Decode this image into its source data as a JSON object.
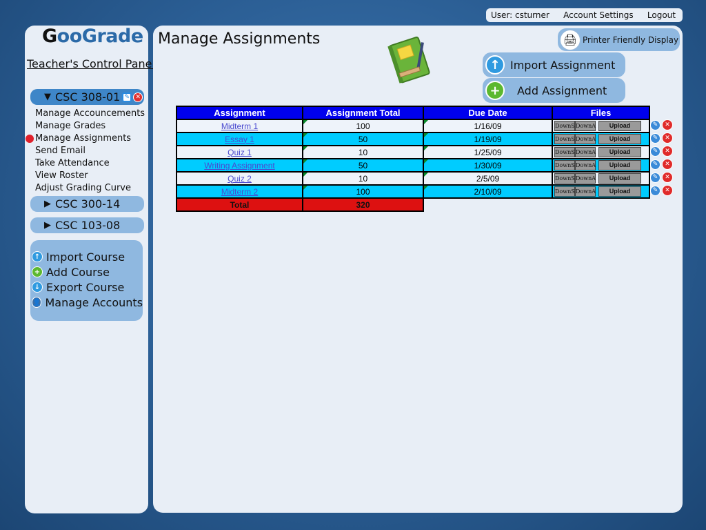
{
  "topbar": {
    "user_text": "User: csturner",
    "account_settings": "Account Settings",
    "logout": "Logout"
  },
  "sidebar": {
    "logo": {
      "g1": "G",
      "oo": "oo",
      "g2": "G",
      "rade": "rade"
    },
    "panel_title": "Teacher's Control Panel",
    "courses": [
      {
        "label": "CSC 308-01",
        "expanded": true
      },
      {
        "label": "CSC 300-14",
        "expanded": false
      },
      {
        "label": "CSC 103-08",
        "expanded": false
      }
    ],
    "subnav": [
      "Manage Accouncements",
      "Manage Grades",
      "Manage Assignments",
      "Send Email",
      "Take Attendance",
      "View Roster",
      "Adjust Grading Curve"
    ],
    "actions": [
      {
        "label": "Import Course",
        "icon": "import-icon"
      },
      {
        "label": "Add Course",
        "icon": "add-icon"
      },
      {
        "label": "Export Course",
        "icon": "export-icon"
      },
      {
        "label": "Manage Accounts",
        "icon": "accounts-icon"
      }
    ]
  },
  "main": {
    "title": "Manage Assignments",
    "printer_button": "Printer Friendly Display",
    "import_button": "Import Assignment",
    "add_button": "Add Assignment",
    "table": {
      "headers": [
        "Assignment",
        "Assignment Total",
        "Due Date",
        "Files"
      ],
      "rows": [
        {
          "name": "Midterm 1",
          "total": "100",
          "due": "1/16/09"
        },
        {
          "name": "Essay 1",
          "total": "50",
          "due": "1/19/09"
        },
        {
          "name": "Quiz 1",
          "total": "10",
          "due": "1/25/09"
        },
        {
          "name": "Writing Assignment",
          "total": "50",
          "due": "1/30/09"
        },
        {
          "name": "Quiz 2",
          "total": "10",
          "due": "2/5/09"
        },
        {
          "name": "Midterm 2",
          "total": "100",
          "due": "2/10/09"
        }
      ],
      "file_buttons": {
        "download_s": "DownS",
        "download_a": "DownA",
        "upload": "Upload"
      },
      "total_label": "Total",
      "total_value": "320"
    }
  },
  "colors": {
    "header_blue": "#0000ee",
    "row_cyan": "#00ccff",
    "total_red": "#dd1111",
    "panel": "#e8eef6",
    "pill": "#8fb8e0"
  }
}
